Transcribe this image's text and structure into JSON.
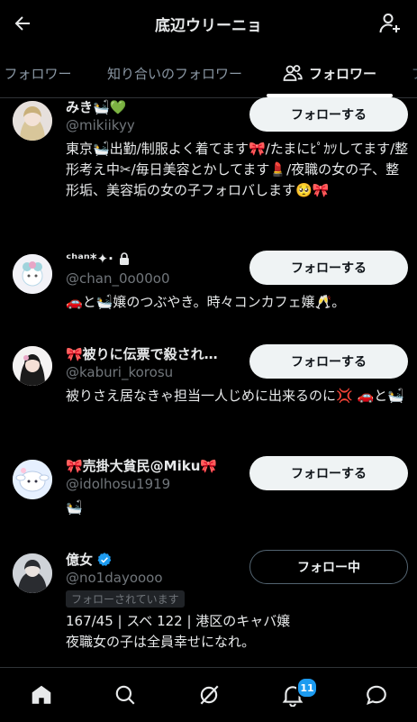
{
  "header": {
    "title": "底辺ウリーニョ"
  },
  "tabs": [
    {
      "label": "フォロワー"
    },
    {
      "label": "知り合いのフォロワー"
    },
    {
      "label": "フォロワー"
    }
  ],
  "follow_label": "フォローする",
  "following_label": "フォロー中",
  "follows_you_label": "フォローされています",
  "users": [
    {
      "name": "みき🛀💚",
      "handle": "@mikiikyy",
      "bio": "東京🛀出勤/制服よく着てます🎀/たまにﾋﾟｶﾂしてます/整形考え中✂︎/毎日美容とかしてます💄/夜職の女の子、整形垢、美容垢の女の子フォロバします🥺🎀"
    },
    {
      "name": "ᶜʰᵃⁿ*✦·",
      "handle": "@chan_0o00o0",
      "bio": "🚗と🛀嬢のつぶやき。時々コンカフェ嬢🥂。"
    },
    {
      "name": "🎀被りに伝票で殺され…",
      "handle": "@kaburi_korosu",
      "bio": "被りさえ居なきゃ担当一人じめに出来るのに💢 🚗と🛀"
    },
    {
      "name": "🎀売掛大貧民@Miku🎀",
      "handle": "@idolhosu1919",
      "bio": "🛀"
    },
    {
      "name": "億女",
      "handle": "@no1dayoooo",
      "bio": "167/45 | スベ 122 | 港区のキャバ嬢\n夜職女の子は全員幸せになれ。"
    }
  ],
  "notifications_badge": "11",
  "colors": {
    "background": "#000000",
    "accent": "#1d9bf0",
    "text": "#e7e9ea",
    "muted": "#71767b"
  }
}
